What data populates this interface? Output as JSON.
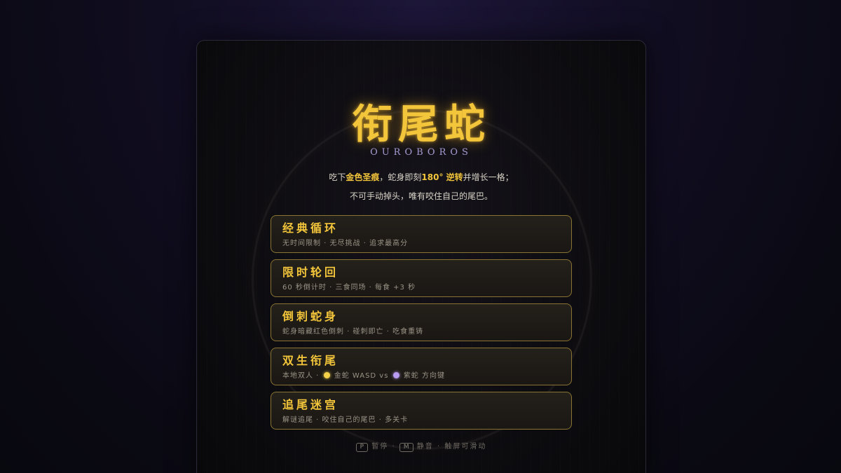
{
  "title": "衔尾蛇",
  "subtitle": "OUROBOROS",
  "intro": {
    "line1_a": "吃下",
    "line1_gold": "金色圣痕",
    "line1_b": "，蛇身即刻",
    "line1_reverse": "180° 逆转",
    "line1_c": "并增长一格；",
    "line2": "不可手动掉头，唯有咬住自己的尾巴。"
  },
  "modes": [
    {
      "name": "经典循环",
      "desc": "无时间限制 · 无尽挑战 · 追求最高分"
    },
    {
      "name": "限时轮回",
      "desc": "60 秒倒计时 · 三食同场 · 每食 +3 秒"
    },
    {
      "name": "倒刺蛇身",
      "desc": "蛇身暗藏红色倒刺 · 碰刺即亡 · 吃食重铸"
    },
    {
      "name": "双生衔尾",
      "desc_a": "本地双人 · ",
      "desc_b": " 金蛇 WASD vs ",
      "desc_c": " 紫蛇 方向键"
    },
    {
      "name": "追尾迷宫",
      "desc": "解谜追尾 · 咬住自己的尾巴 · 多关卡"
    }
  ],
  "footer": {
    "pause_key": "P",
    "pause_label": "暂停",
    "mute_key": "M",
    "mute_label": "静音",
    "sep": "·",
    "touch": "触屏可滑动"
  },
  "colors": {
    "gold": "#f3c53a",
    "purple_accent": "#a79bd4",
    "gold_snake": "#f5d24a",
    "purple_snake": "#b89af0"
  }
}
